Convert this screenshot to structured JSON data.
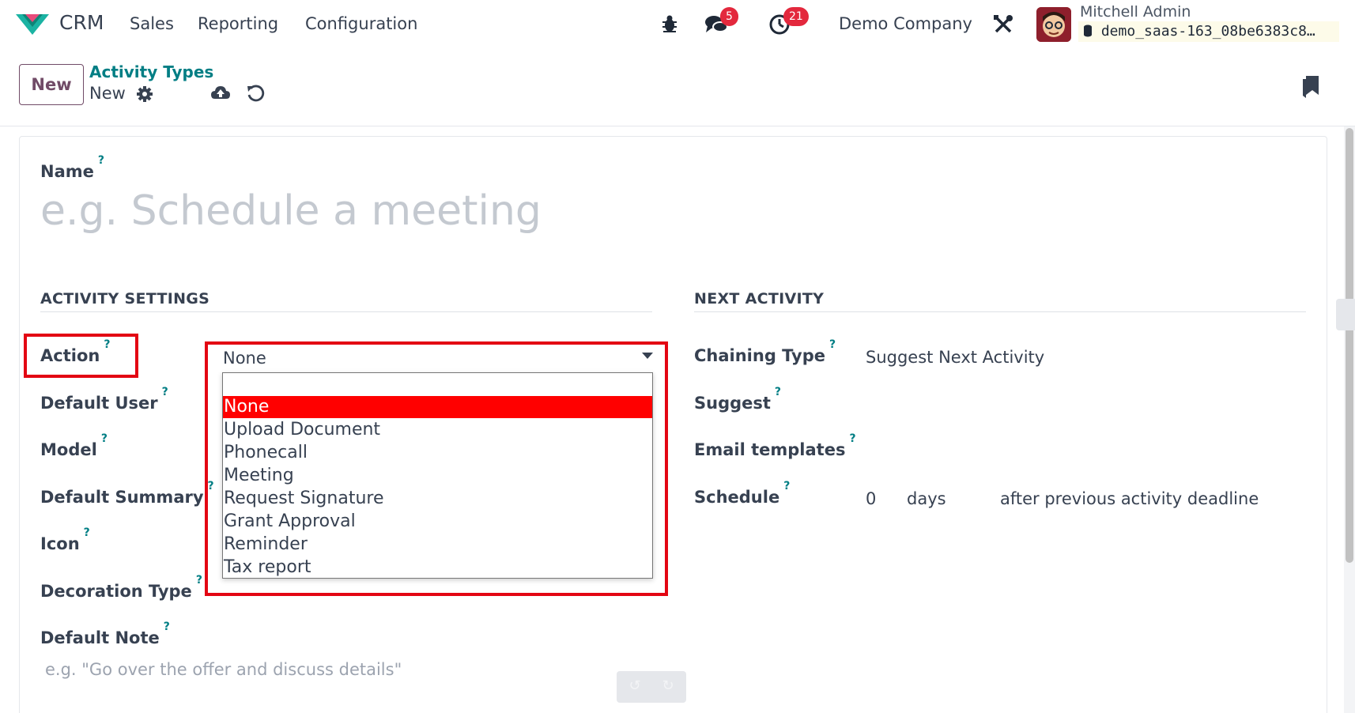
{
  "navbar": {
    "app_name": "CRM",
    "menus": [
      "Sales",
      "Reporting",
      "Configuration"
    ],
    "messages_count": "5",
    "activities_count": "21",
    "company": "Demo Company",
    "user_name": "Mitchell Admin",
    "database": "demo_saas-163_08be6383c8…",
    "icons": [
      "debug-icon",
      "chat-icon",
      "clock-icon",
      "tools-icon",
      "database-icon"
    ]
  },
  "control_panel": {
    "new_label": "New",
    "breadcrumb_parent": "Activity Types",
    "breadcrumb_current": "New",
    "icons": [
      "gear-icon",
      "cloud-upload-icon",
      "undo-icon",
      "bookmark-icon"
    ]
  },
  "form": {
    "name_label": "Name",
    "name_placeholder": "e.g. Schedule a meeting",
    "activity_settings_title": "ACTIVITY SETTINGS",
    "next_activity_title": "NEXT ACTIVITY",
    "action_label": "Action",
    "action_value": "None",
    "default_user_label": "Default User",
    "model_label": "Model",
    "default_summary_label": "Default Summary",
    "icon_label": "Icon",
    "decoration_type_label": "Decoration Type",
    "default_note_label": "Default Note",
    "default_note_placeholder": "e.g. \"Go over the offer and discuss details\"",
    "chaining_type_label": "Chaining Type",
    "chaining_type_value": "Suggest Next Activity",
    "suggest_label": "Suggest",
    "email_templates_label": "Email templates",
    "schedule_label": "Schedule",
    "schedule_value": "0",
    "schedule_unit": "days",
    "schedule_trigger": "after previous activity deadline",
    "help_mark": "?"
  },
  "action_dropdown": {
    "options": [
      "",
      "None",
      "Upload Document",
      "Phonecall",
      "Meeting",
      "Request Signature",
      "Grant Approval",
      "Reminder",
      "Tax report"
    ],
    "selected": "None"
  },
  "colors": {
    "brand": "#714b67",
    "link": "#017e84",
    "highlight": "#e30613",
    "selected_option": "#ff0000",
    "badge": "#e3283d"
  }
}
